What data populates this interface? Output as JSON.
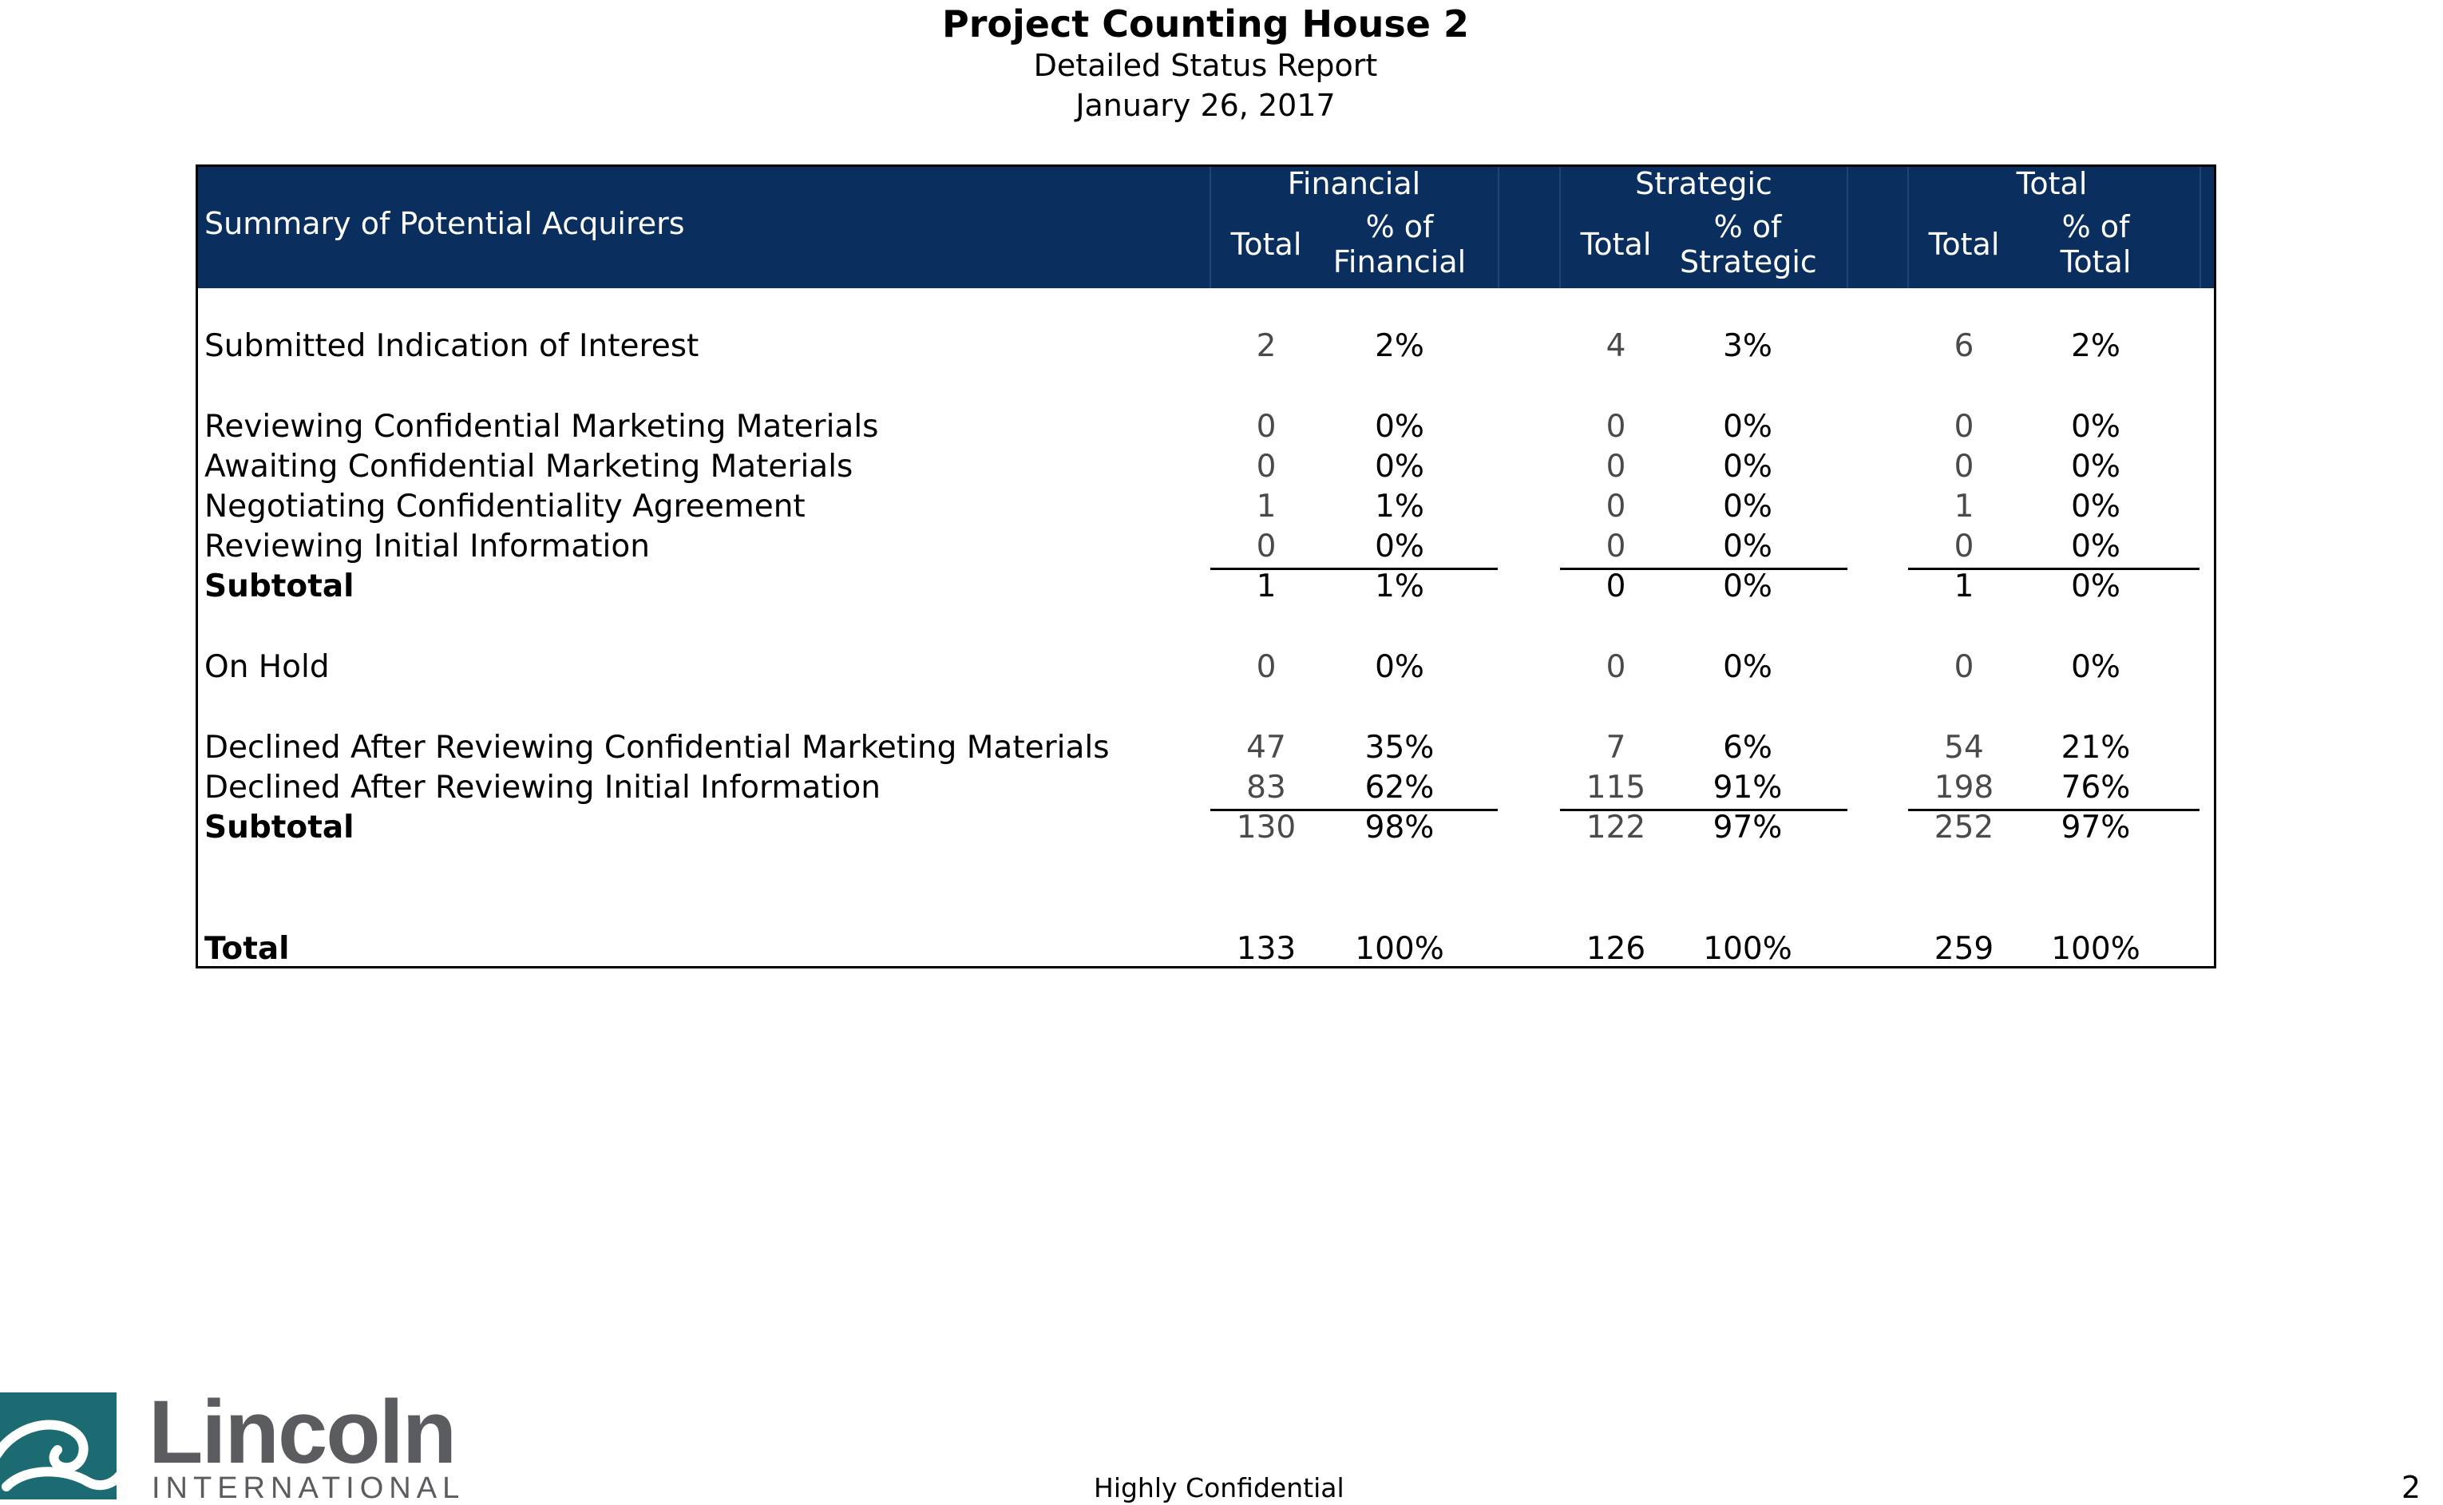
{
  "header": {
    "title": "Project Counting House 2",
    "subtitle": "Detailed Status Report",
    "date": "January 26, 2017"
  },
  "table": {
    "summary_label": "Summary of Potential Acquirers",
    "groups": [
      {
        "name": "Financial",
        "total_label": "Total",
        "pct_label_1": "% of",
        "pct_label_2": "Financial"
      },
      {
        "name": "Strategic",
        "total_label": "Total",
        "pct_label_1": "% of",
        "pct_label_2": "Strategic"
      },
      {
        "name": "Total",
        "total_label": "Total",
        "pct_label_1": "% of",
        "pct_label_2": "Total"
      }
    ],
    "rows": [
      {
        "label": "Submitted Indication of Interest",
        "bold": false,
        "values": [
          "2",
          "2%",
          "4",
          "3%",
          "6",
          "2%"
        ]
      },
      {
        "label": "Reviewing Confidential Marketing Materials",
        "bold": false,
        "values": [
          "0",
          "0%",
          "0",
          "0%",
          "0",
          "0%"
        ]
      },
      {
        "label": "Awaiting Confidential Marketing Materials",
        "bold": false,
        "values": [
          "0",
          "0%",
          "0",
          "0%",
          "0",
          "0%"
        ]
      },
      {
        "label": "Negotiating Confidentiality Agreement",
        "bold": false,
        "values": [
          "1",
          "1%",
          "0",
          "0%",
          "1",
          "0%"
        ]
      },
      {
        "label": "Reviewing Initial Information",
        "bold": false,
        "values": [
          "0",
          "0%",
          "0",
          "0%",
          "0",
          "0%"
        ]
      },
      {
        "label": "Subtotal",
        "bold": true,
        "values": [
          "1",
          "1%",
          "0",
          "0%",
          "1",
          "0%"
        ]
      },
      {
        "label": "On Hold",
        "bold": false,
        "values": [
          "0",
          "0%",
          "0",
          "0%",
          "0",
          "0%"
        ]
      },
      {
        "label": "Declined After Reviewing Confidential Marketing Materials",
        "bold": false,
        "values": [
          "47",
          "35%",
          "7",
          "6%",
          "54",
          "21%"
        ]
      },
      {
        "label": "Declined After Reviewing Initial Information",
        "bold": false,
        "values": [
          "83",
          "62%",
          "115",
          "91%",
          "198",
          "76%"
        ]
      },
      {
        "label": "Subtotal",
        "bold": true,
        "values": [
          "130",
          "98%",
          "122",
          "97%",
          "252",
          "97%"
        ]
      },
      {
        "label": "Total",
        "bold": true,
        "values": [
          "133",
          "100%",
          "126",
          "100%",
          "259",
          "100%"
        ]
      }
    ]
  },
  "footer": {
    "logo_word": "Lincoln",
    "logo_sub": "INTERNATIONAL",
    "confidentiality": "Highly Confidential",
    "page_number": "2"
  },
  "colors": {
    "header_band": "#0a2f5e",
    "logo_teal": "#1c6b73",
    "logo_gray": "#5a5c5f"
  }
}
